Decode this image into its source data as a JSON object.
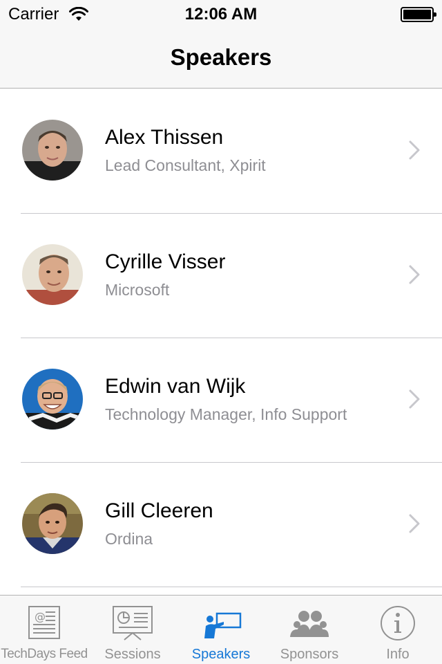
{
  "status_bar": {
    "carrier": "Carrier",
    "time": "12:06 AM",
    "battery_level": 1.0
  },
  "nav": {
    "title": "Speakers"
  },
  "speakers": [
    {
      "name": "Alex Thissen",
      "subtitle": "Lead Consultant, Xpirit",
      "avatar_icon": "avatar-photo"
    },
    {
      "name": "Cyrille Visser",
      "subtitle": "Microsoft",
      "avatar_icon": "avatar-photo"
    },
    {
      "name": "Edwin van Wijk",
      "subtitle": "Technology Manager, Info Support",
      "avatar_icon": "avatar-photo"
    },
    {
      "name": "Gill Cleeren",
      "subtitle": "Ordina",
      "avatar_icon": "avatar-photo"
    }
  ],
  "tabs": [
    {
      "label": "TechDays Feed",
      "icon": "newspaper-icon",
      "active": false
    },
    {
      "label": "Sessions",
      "icon": "presentation-icon",
      "active": false
    },
    {
      "label": "Speakers",
      "icon": "speaker-icon",
      "active": true
    },
    {
      "label": "Sponsors",
      "icon": "people-icon",
      "active": false
    },
    {
      "label": "Info",
      "icon": "info-icon",
      "active": false
    }
  ],
  "colors": {
    "accent": "#1678d6",
    "inactive": "#929292",
    "subtitle": "#8e8e93"
  }
}
